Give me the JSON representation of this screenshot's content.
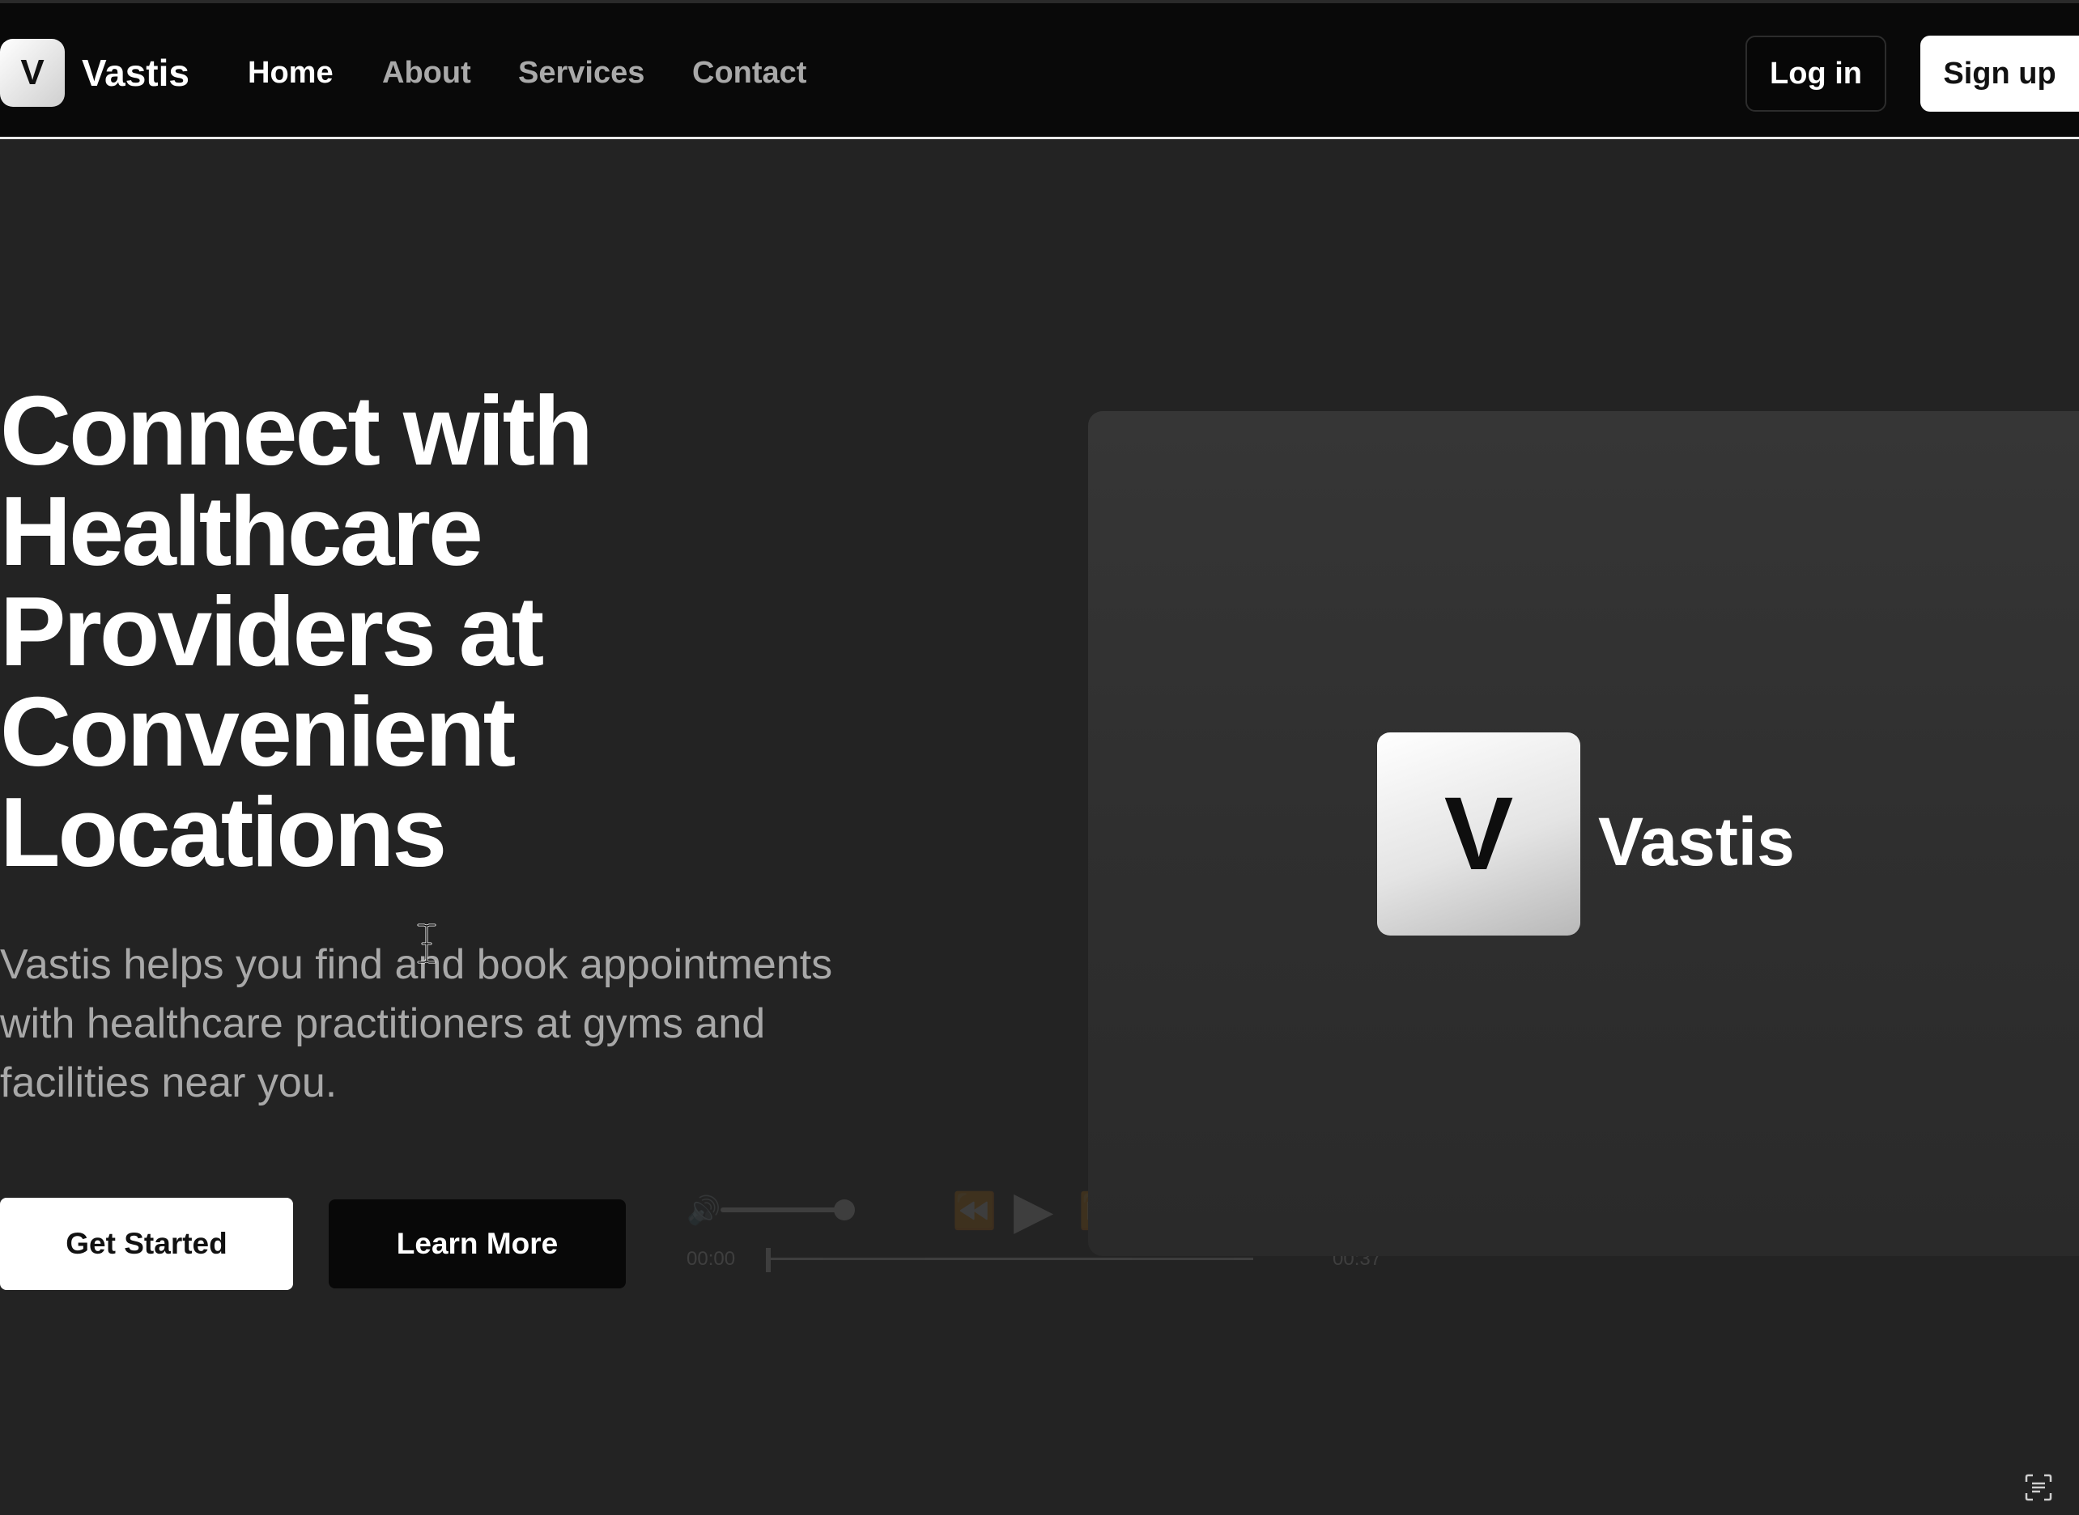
{
  "brand": {
    "logo_letter": "V",
    "name": "Vastis"
  },
  "nav": {
    "items": [
      {
        "label": "Home",
        "active": true
      },
      {
        "label": "About",
        "active": false
      },
      {
        "label": "Services",
        "active": false
      },
      {
        "label": "Contact",
        "active": false
      }
    ]
  },
  "auth": {
    "login_label": "Log in",
    "signup_label": "Sign up"
  },
  "hero": {
    "title": "Connect with Healthcare Providers at Convenient Locations",
    "subtitle": "Vastis helps you find and book appointments with healthcare practitioners at gyms and facilities near you.",
    "primary_cta": "Get Started",
    "secondary_cta": "Learn More"
  },
  "video": {
    "logo_letter": "V",
    "brand_name": "Vastis",
    "time_current": "00:00",
    "time_total": "00:37",
    "progress": 0.0,
    "icons": [
      "volume-icon",
      "rewind-icon",
      "play-icon",
      "fast-forward-icon",
      "airplay-icon",
      "picture-in-picture-icon",
      "more-icon"
    ]
  },
  "colors": {
    "background": "#232323",
    "navbar": "#090909",
    "accent_white": "#ffffff",
    "muted_text": "#a8a8a8"
  }
}
